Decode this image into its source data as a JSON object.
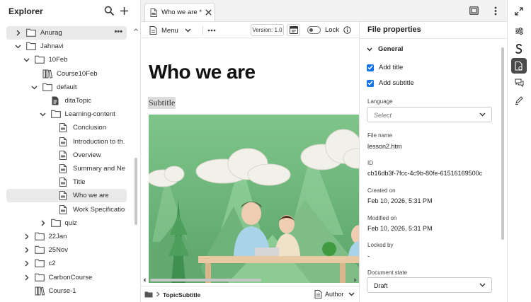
{
  "explorer": {
    "title": "Explorer",
    "tree": [
      {
        "label": "Anurag",
        "level": 0,
        "chevron": "right",
        "icon": "folder-icon",
        "selected": true,
        "more": "•••"
      },
      {
        "label": "Jahnavi",
        "level": 0,
        "chevron": "down",
        "icon": "folder-icon"
      },
      {
        "label": "10Feb",
        "level": 1,
        "chevron": "down",
        "icon": "folder-icon"
      },
      {
        "label": "Course10Feb",
        "level": 2,
        "chevron": "",
        "icon": "map-icon"
      },
      {
        "label": "default",
        "level": 2,
        "chevron": "down",
        "icon": "folder-icon"
      },
      {
        "label": "ditaTopic",
        "level": 3,
        "chevron": "",
        "icon": "document-icon"
      },
      {
        "label": "Learning-content",
        "level": 3,
        "chevron": "down",
        "icon": "folder-icon"
      },
      {
        "label": "Conclusion",
        "level": 4,
        "chevron": "",
        "icon": "topic-icon"
      },
      {
        "label": "Introduction to th...",
        "level": 4,
        "chevron": "",
        "icon": "topic-icon"
      },
      {
        "label": "Overview",
        "level": 4,
        "chevron": "",
        "icon": "topic-icon"
      },
      {
        "label": "Summary and Ne...",
        "level": 4,
        "chevron": "",
        "icon": "topic-icon"
      },
      {
        "label": "Title",
        "level": 4,
        "chevron": "",
        "icon": "topic-icon"
      },
      {
        "label": "Who we are",
        "level": 4,
        "chevron": "",
        "icon": "topic-icon",
        "selected": true
      },
      {
        "label": "Work Specification...",
        "level": 4,
        "chevron": "",
        "icon": "topic-icon"
      },
      {
        "label": "quiz",
        "level": 3,
        "chevron": "right",
        "icon": "folder-icon"
      },
      {
        "label": "22Jan",
        "level": 1,
        "chevron": "right",
        "icon": "folder-icon"
      },
      {
        "label": "25Nov",
        "level": 1,
        "chevron": "right",
        "icon": "folder-icon"
      },
      {
        "label": "c2",
        "level": 1,
        "chevron": "right",
        "icon": "folder-icon"
      },
      {
        "label": "CarbonCourse",
        "level": 1,
        "chevron": "right",
        "icon": "folder-icon"
      },
      {
        "label": "Course-1",
        "level": 1,
        "chevron": "",
        "icon": "map-icon"
      }
    ]
  },
  "tab": {
    "label": "Who we are *"
  },
  "toolbar": {
    "menu_label": "Menu",
    "version_label": "Version: 1.0",
    "lock_label": "Lock"
  },
  "document": {
    "title": "Who we are",
    "subtitle": "Subtitle"
  },
  "statusbar": {
    "breadcrumb": "TopicSubtitle",
    "mode": "Author"
  },
  "properties": {
    "title": "File properties",
    "section": "General",
    "add_title": "Add title",
    "add_subtitle": "Add subtitle",
    "language_label": "Language",
    "language_placeholder": "Select",
    "file_name_label": "File name",
    "file_name": "lesson2.htm",
    "id_label": "ID",
    "id_value": "cb16db3f-7fcc-4c9b-80fe-61516169500c",
    "created_label": "Created on",
    "created_value": "Feb 10, 2026, 5:31 PM",
    "modified_label": "Modified on",
    "modified_value": "Feb 10, 2026, 5:31 PM",
    "locked_label": "Locked by",
    "locked_value": "-",
    "state_label": "Document state",
    "state_value": "Draft"
  },
  "colors": {
    "accent": "#1473e6",
    "selected_row": "#e9e9e9",
    "rail_active": "#4a4a4a"
  }
}
